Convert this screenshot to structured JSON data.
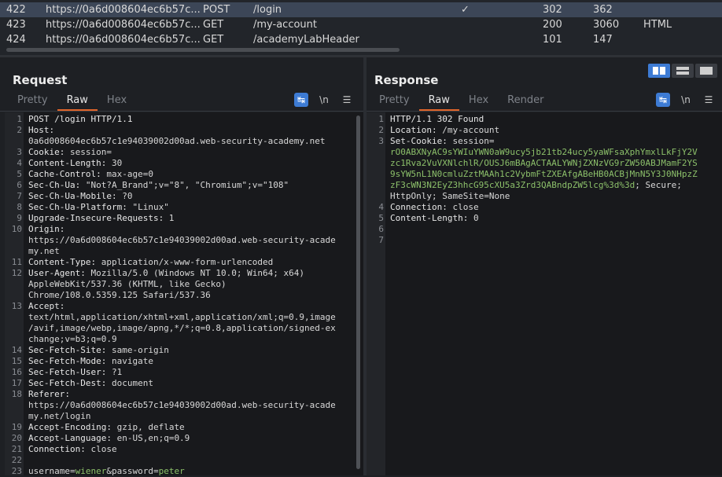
{
  "history": {
    "rows": [
      {
        "num": "422",
        "url": "https://0a6d008604ec6b57c...",
        "method": "POST",
        "path": "/login",
        "edited": "✓",
        "status": "302",
        "length": "362",
        "mime": ""
      },
      {
        "num": "423",
        "url": "https://0a6d008604ec6b57c...",
        "method": "GET",
        "path": "/my-account",
        "edited": "",
        "status": "200",
        "length": "3060",
        "mime": "HTML"
      },
      {
        "num": "424",
        "url": "https://0a6d008604ec6b57c...",
        "method": "GET",
        "path": "/academyLabHeader",
        "edited": "",
        "status": "101",
        "length": "147",
        "mime": ""
      }
    ]
  },
  "request": {
    "title": "Request",
    "tabs": [
      "Pretty",
      "Raw",
      "Hex"
    ],
    "wrap_label": "\\n",
    "menu_icon": "hamburger-icon",
    "lines": [
      {
        "n": "1",
        "parts": [
          {
            "t": "POST /login HTTP/1.1",
            "c": "k"
          }
        ]
      },
      {
        "n": "2",
        "parts": [
          {
            "t": "Host:",
            "c": "k"
          }
        ]
      },
      {
        "n": "",
        "parts": [
          {
            "t": "0a6d008604ec6b57c1e94039002d00ad.web-security-academy.net",
            "c": ""
          }
        ]
      },
      {
        "n": "3",
        "parts": [
          {
            "t": "Cookie:",
            "c": "k"
          },
          {
            "t": " session=",
            "c": ""
          }
        ]
      },
      {
        "n": "4",
        "parts": [
          {
            "t": "Content-Length:",
            "c": "k"
          },
          {
            "t": " 30",
            "c": ""
          }
        ]
      },
      {
        "n": "5",
        "parts": [
          {
            "t": "Cache-Control:",
            "c": "k"
          },
          {
            "t": " max-age=0",
            "c": ""
          }
        ]
      },
      {
        "n": "6",
        "parts": [
          {
            "t": "Sec-Ch-Ua:",
            "c": "k"
          },
          {
            "t": " \"Not?A_Brand\";v=\"8\", \"Chromium\";v=\"108\"",
            "c": ""
          }
        ]
      },
      {
        "n": "7",
        "parts": [
          {
            "t": "Sec-Ch-Ua-Mobile:",
            "c": "k"
          },
          {
            "t": " ?0",
            "c": ""
          }
        ]
      },
      {
        "n": "8",
        "parts": [
          {
            "t": "Sec-Ch-Ua-Platform:",
            "c": "k"
          },
          {
            "t": " \"Linux\"",
            "c": ""
          }
        ]
      },
      {
        "n": "9",
        "parts": [
          {
            "t": "Upgrade-Insecure-Requests:",
            "c": "k"
          },
          {
            "t": " 1",
            "c": ""
          }
        ]
      },
      {
        "n": "10",
        "parts": [
          {
            "t": "Origin:",
            "c": "k"
          }
        ]
      },
      {
        "n": "",
        "parts": [
          {
            "t": "https://0a6d008604ec6b57c1e94039002d00ad.web-security-acade",
            "c": ""
          }
        ]
      },
      {
        "n": "",
        "parts": [
          {
            "t": "my.net",
            "c": ""
          }
        ]
      },
      {
        "n": "11",
        "parts": [
          {
            "t": "Content-Type:",
            "c": "k"
          },
          {
            "t": " application/x-www-form-urlencoded",
            "c": ""
          }
        ]
      },
      {
        "n": "12",
        "parts": [
          {
            "t": "User-Agent:",
            "c": "k"
          },
          {
            "t": " Mozilla/5.0 (Windows NT 10.0; Win64; x64)",
            "c": ""
          }
        ]
      },
      {
        "n": "",
        "parts": [
          {
            "t": "AppleWebKit/537.36 (KHTML, like Gecko)",
            "c": ""
          }
        ]
      },
      {
        "n": "",
        "parts": [
          {
            "t": "Chrome/108.0.5359.125 Safari/537.36",
            "c": ""
          }
        ]
      },
      {
        "n": "13",
        "parts": [
          {
            "t": "Accept:",
            "c": "k"
          }
        ]
      },
      {
        "n": "",
        "parts": [
          {
            "t": "text/html,application/xhtml+xml,application/xml;q=0.9,image",
            "c": ""
          }
        ]
      },
      {
        "n": "",
        "parts": [
          {
            "t": "/avif,image/webp,image/apng,*/*;q=0.8,application/signed-ex",
            "c": ""
          }
        ]
      },
      {
        "n": "",
        "parts": [
          {
            "t": "change;v=b3;q=0.9",
            "c": ""
          }
        ]
      },
      {
        "n": "14",
        "parts": [
          {
            "t": "Sec-Fetch-Site:",
            "c": "k"
          },
          {
            "t": " same-origin",
            "c": ""
          }
        ]
      },
      {
        "n": "15",
        "parts": [
          {
            "t": "Sec-Fetch-Mode:",
            "c": "k"
          },
          {
            "t": " navigate",
            "c": ""
          }
        ]
      },
      {
        "n": "16",
        "parts": [
          {
            "t": "Sec-Fetch-User:",
            "c": "k"
          },
          {
            "t": " ?1",
            "c": ""
          }
        ]
      },
      {
        "n": "17",
        "parts": [
          {
            "t": "Sec-Fetch-Dest:",
            "c": "k"
          },
          {
            "t": " document",
            "c": ""
          }
        ]
      },
      {
        "n": "18",
        "parts": [
          {
            "t": "Referer:",
            "c": "k"
          }
        ]
      },
      {
        "n": "",
        "parts": [
          {
            "t": "https://0a6d008604ec6b57c1e94039002d00ad.web-security-acade",
            "c": ""
          }
        ]
      },
      {
        "n": "",
        "parts": [
          {
            "t": "my.net/login",
            "c": ""
          }
        ]
      },
      {
        "n": "19",
        "parts": [
          {
            "t": "Accept-Encoding:",
            "c": "k"
          },
          {
            "t": " gzip, deflate",
            "c": ""
          }
        ]
      },
      {
        "n": "20",
        "parts": [
          {
            "t": "Accept-Language:",
            "c": "k"
          },
          {
            "t": " en-US,en;q=0.9",
            "c": ""
          }
        ]
      },
      {
        "n": "21",
        "parts": [
          {
            "t": "Connection:",
            "c": "k"
          },
          {
            "t": " close",
            "c": ""
          }
        ]
      },
      {
        "n": "22",
        "parts": [
          {
            "t": "",
            "c": ""
          }
        ]
      },
      {
        "n": "23",
        "parts": [
          {
            "t": "username=",
            "c": ""
          },
          {
            "t": "wiener",
            "c": "g"
          },
          {
            "t": "&password=",
            "c": ""
          },
          {
            "t": "peter",
            "c": "g"
          }
        ]
      }
    ]
  },
  "response": {
    "title": "Response",
    "tabs": [
      "Pretty",
      "Raw",
      "Hex",
      "Render"
    ],
    "wrap_label": "\\n",
    "lines": [
      {
        "n": "1",
        "parts": [
          {
            "t": "HTTP/1.1 302 Found",
            "c": "k"
          }
        ]
      },
      {
        "n": "2",
        "parts": [
          {
            "t": "Location:",
            "c": "k"
          },
          {
            "t": " /my-account",
            "c": ""
          }
        ]
      },
      {
        "n": "3",
        "parts": [
          {
            "t": "Set-Cookie:",
            "c": "k"
          },
          {
            "t": " session=",
            "c": ""
          }
        ]
      },
      {
        "n": "",
        "parts": [
          {
            "t": "rO0ABXNyAC9sYWIuYWN0aW9ucy5jb21tb24ucy5yaWFsaXphYmxlLkFjY2V",
            "c": "g"
          }
        ]
      },
      {
        "n": "",
        "parts": [
          {
            "t": "zc1Rva2VuVXNlchlR/OUSJ6mBAgACTAALYWNjZXNzVG9rZW50ABJMamF2YS",
            "c": "g"
          }
        ]
      },
      {
        "n": "",
        "parts": [
          {
            "t": "9sYW5nL1N0cmluZztMAAh1c2VybmFtZXEAfgABeHB0ACBjMnN5Y3J0NHpzZ",
            "c": "g"
          }
        ]
      },
      {
        "n": "",
        "parts": [
          {
            "t": "zF3cWN3N2EyZ3hhcG95cXU5a3Zrd3QABndpZW5lcg%3d%3d",
            "c": "g"
          },
          {
            "t": "; Secure;",
            "c": ""
          }
        ]
      },
      {
        "n": "",
        "parts": [
          {
            "t": "HttpOnly; SameSite=None",
            "c": ""
          }
        ]
      },
      {
        "n": "4",
        "parts": [
          {
            "t": "Connection:",
            "c": "k"
          },
          {
            "t": " close",
            "c": ""
          }
        ]
      },
      {
        "n": "5",
        "parts": [
          {
            "t": "Content-Length:",
            "c": "k"
          },
          {
            "t": " 0",
            "c": ""
          }
        ]
      },
      {
        "n": "6",
        "parts": [
          {
            "t": "",
            "c": ""
          }
        ]
      },
      {
        "n": "7",
        "parts": [
          {
            "t": "",
            "c": ""
          }
        ]
      }
    ]
  },
  "colors": {
    "accent": "#e2662b",
    "selected_row": "#3c4657",
    "string_value": "#8cc06a",
    "button_blue": "#3d7bd4"
  }
}
